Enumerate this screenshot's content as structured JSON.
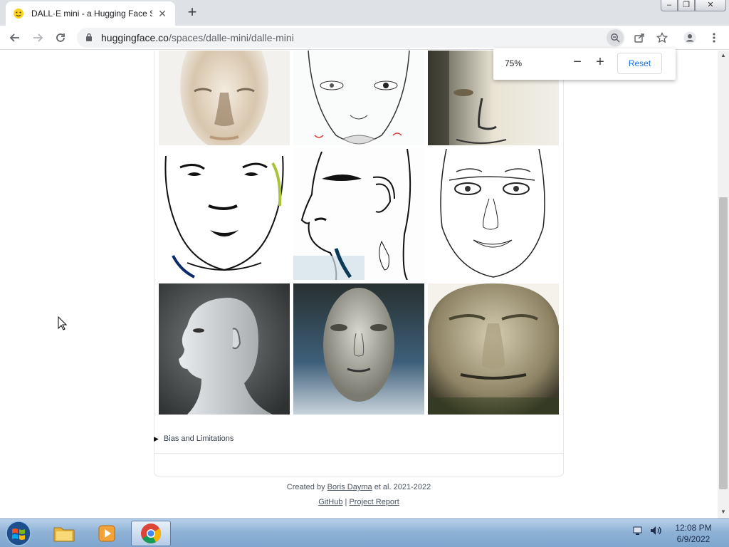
{
  "browser": {
    "tab_title": "DALL·E mini - a Hugging Face Sp",
    "tab_close": "✕",
    "new_tab": "+",
    "url_host": "huggingface.co",
    "url_path": "/spaces/dalle-mini/dalle-mini",
    "window_controls": {
      "minimize": "–",
      "maximize": "❐",
      "close": "✕"
    }
  },
  "zoom_bubble": {
    "percent": "75%",
    "minus": "−",
    "plus": "+",
    "reset": "Reset"
  },
  "page": {
    "images": [
      "face-1",
      "face-2",
      "face-3",
      "face-4",
      "face-5",
      "face-6",
      "face-7",
      "face-8",
      "face-9"
    ],
    "bias_toggle": "Bias and Limitations",
    "credits": {
      "created_by": "Created by",
      "author": "Boris Dayma",
      "suffix": "et al. 2021-2022",
      "github": "GitHub",
      "separator": "|",
      "report": "Project Report"
    }
  },
  "taskbar": {
    "time": "12:08 PM",
    "date": "6/9/2022"
  }
}
